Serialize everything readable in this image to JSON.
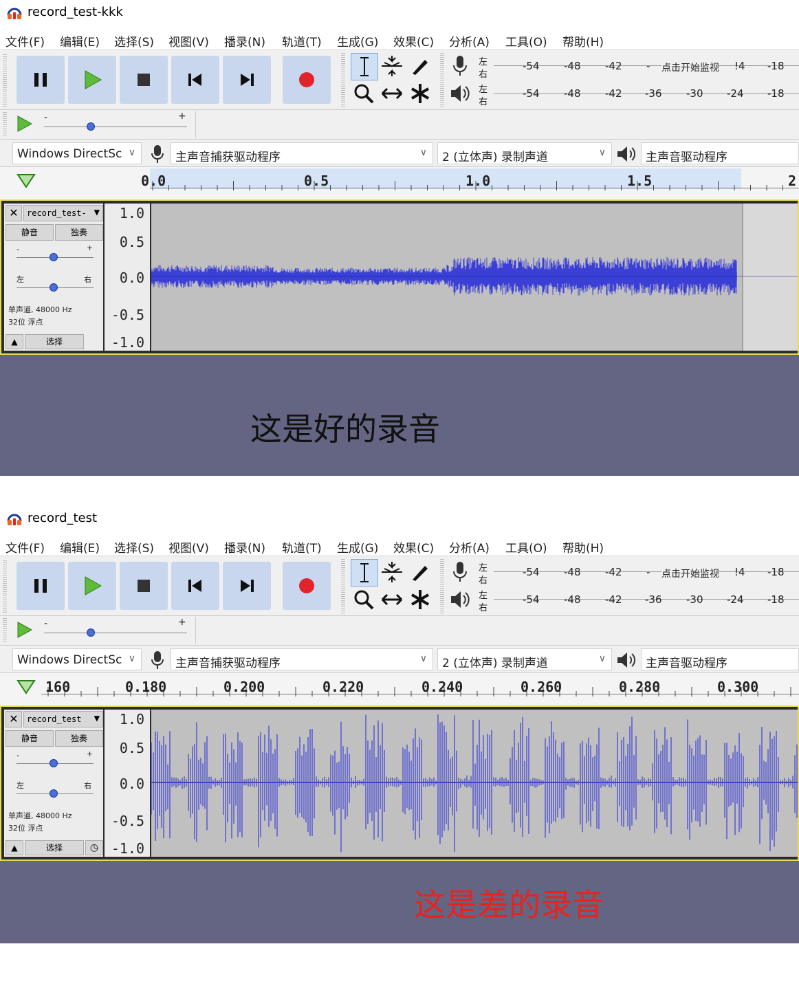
{
  "windows": [
    {
      "title": "record_test-kkk",
      "menu": [
        "文件(F)",
        "编辑(E)",
        "选择(S)",
        "视图(V)",
        "播录(N)",
        "轨道(T)",
        "生成(G)",
        "效果(C)",
        "分析(A)",
        "工具(O)",
        "帮助(H)"
      ],
      "meter_ticks_rec": [
        "-54",
        "-48",
        "-42",
        "-",
        "点击开始监视",
        "!4",
        "-18"
      ],
      "meter_ticks_play": [
        "-54",
        "-48",
        "-42",
        "-36",
        "-30",
        "-24",
        "-18"
      ],
      "meter_lr": [
        "左",
        "右"
      ],
      "host": "Windows DirectSc",
      "rec_device": "主声音捕获驱动程序",
      "channels": "2 (立体声) 录制声道",
      "play_device": "主声音驱动程序",
      "ruler_labels": [
        "0.0",
        "0.5",
        "1.0",
        "1.5",
        "2"
      ],
      "track": {
        "name": "record_test-",
        "mute": "静音",
        "solo": "独奏",
        "gain_minus": "-",
        "gain_plus": "+",
        "pan_left": "左",
        "pan_right": "右",
        "info_line1": "单声道, 48000 Hz",
        "info_line2": "32位 浮点",
        "select": "选择",
        "scale": [
          "1.0",
          "0.5",
          "0.0",
          "-0.5",
          "-1.0"
        ]
      },
      "caption": "这是好的录音",
      "caption_color": "#111111",
      "waveform": "good"
    },
    {
      "title": "record_test",
      "menu": [
        "文件(F)",
        "编辑(E)",
        "选择(S)",
        "视图(V)",
        "播录(N)",
        "轨道(T)",
        "生成(G)",
        "效果(C)",
        "分析(A)",
        "工具(O)",
        "帮助(H)"
      ],
      "meter_ticks_rec": [
        "-54",
        "-48",
        "-42",
        "-",
        "点击开始监视",
        "!4",
        "-18"
      ],
      "meter_ticks_play": [
        "-54",
        "-48",
        "-42",
        "-36",
        "-30",
        "-24",
        "-18"
      ],
      "meter_lr": [
        "左",
        "右"
      ],
      "host": "Windows DirectSc",
      "rec_device": "主声音捕获驱动程序",
      "channels": "2 (立体声) 录制声道",
      "play_device": "主声音驱动程序",
      "ruler_labels": [
        "160",
        "0.180",
        "0.200",
        "0.220",
        "0.240",
        "0.260",
        "0.280",
        "0.300"
      ],
      "track": {
        "name": "record_test",
        "mute": "静音",
        "solo": "独奏",
        "gain_minus": "-",
        "gain_plus": "+",
        "pan_left": "左",
        "pan_right": "右",
        "info_line1": "单声道, 48000 Hz",
        "info_line2": "32位 浮点",
        "select": "选择",
        "scale": [
          "1.0",
          "0.5",
          "0.0",
          "-0.5",
          "-1.0"
        ]
      },
      "caption": "这是差的录音",
      "caption_color": "#e8231f",
      "waveform": "bad"
    }
  ],
  "colors": {
    "waveform": "#3b3fd6",
    "wave_bg": "#c0c0c0",
    "track_border": "#e6da57",
    "button_bg": "#c9d7ee",
    "caption_bg": "#636582"
  }
}
